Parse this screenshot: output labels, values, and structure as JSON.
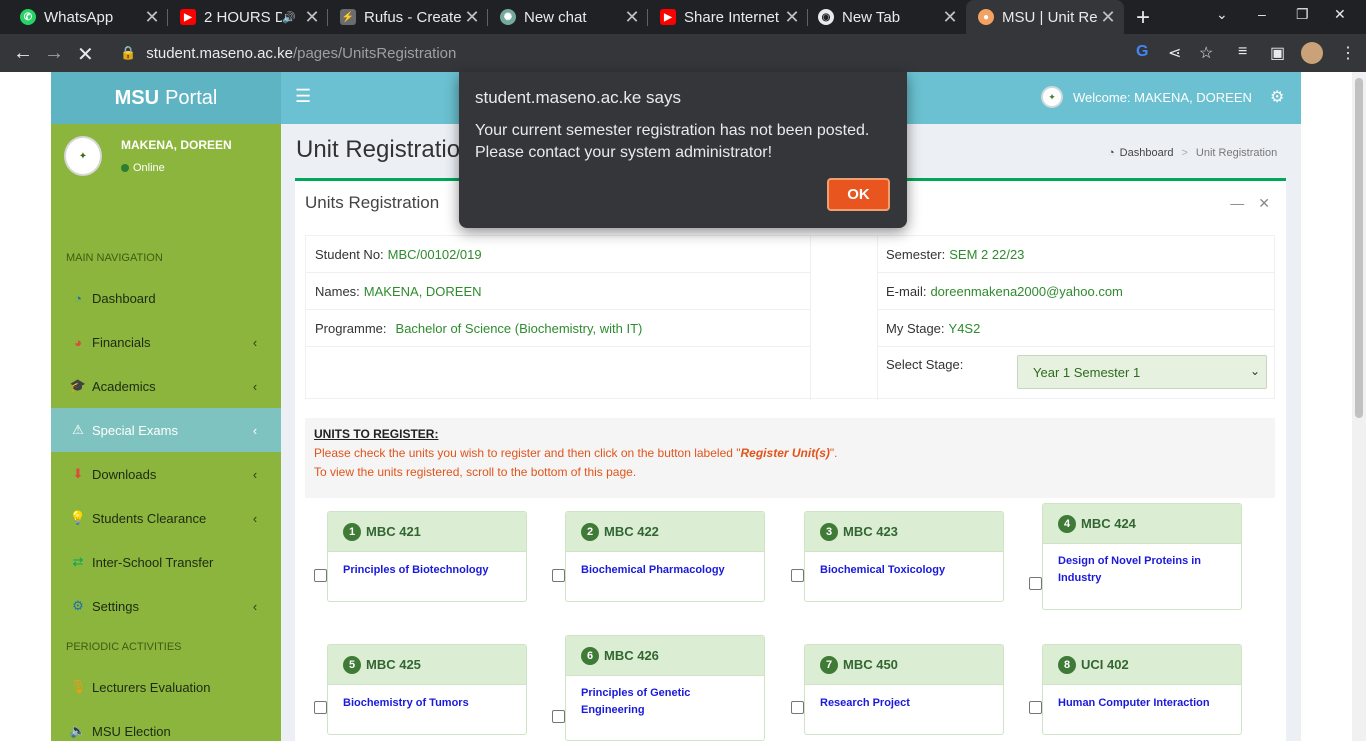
{
  "browser": {
    "tabs": [
      {
        "title": "WhatsApp",
        "icon": "whatsapp-icon",
        "color": "#25d366"
      },
      {
        "title": "2 HOURS D",
        "icon": "youtube-icon",
        "color": "#ff0000",
        "audio": "🔊"
      },
      {
        "title": "Rufus - Create",
        "icon": "rufus-icon",
        "color": "#7a7a7a"
      },
      {
        "title": "New chat",
        "icon": "chatgpt-icon",
        "color": "#74aa9c"
      },
      {
        "title": "Share Internet",
        "icon": "youtube-icon",
        "color": "#ff0000"
      },
      {
        "title": "New Tab",
        "icon": "chrome-icon",
        "color": "#e8eaed"
      },
      {
        "title": "MSU | Unit Reg",
        "icon": "msu-icon",
        "color": "#f4a261"
      }
    ],
    "url_host": "student.maseno.ac.ke",
    "url_path": "/pages/UnitsRegistration"
  },
  "header": {
    "logo_bold": "MSU",
    "logo_rest": "Portal",
    "welcome": "Welcome: MAKENA, DOREEN"
  },
  "sidebar": {
    "user_name": "MAKENA, DOREEN",
    "status": "Online",
    "main_nav_header": "MAIN NAVIGATION",
    "periodic_header": "PERIODIC ACTIVITIES",
    "items": [
      {
        "label": "Dashboard",
        "icon": "dashboard-icon"
      },
      {
        "label": "Financials",
        "icon": "pie-chart-icon"
      },
      {
        "label": "Academics",
        "icon": "graduation-cap-icon"
      },
      {
        "label": "Special Exams",
        "icon": "warning-icon"
      },
      {
        "label": "Downloads",
        "icon": "download-icon"
      },
      {
        "label": "Students Clearance",
        "icon": "lightbulb-icon"
      },
      {
        "label": "Inter-School Transfer",
        "icon": "transfer-icon"
      },
      {
        "label": "Settings",
        "icon": "cogs-icon"
      }
    ],
    "periodic_items": [
      {
        "label": "Lecturers Evaluation",
        "icon": "microphone-icon"
      },
      {
        "label": "MSU Election",
        "icon": "volume-icon"
      }
    ]
  },
  "content": {
    "page_title": "Unit Registration",
    "breadcrumb_home": "Dashboard",
    "breadcrumb_current": "Unit Registration",
    "box_title": "Units Registration"
  },
  "student": {
    "student_no_label": "Student No:",
    "student_no": "MBC/00102/019",
    "names_label": "Names:",
    "names": "MAKENA, DOREEN",
    "programme_label": "Programme:",
    "programme": "Bachelor of Science (Biochemistry, with IT)",
    "semester_label": "Semester:",
    "semester": "SEM 2 22/23",
    "email_label": "E-mail:",
    "email": "doreenmakena2000@yahoo.com",
    "stage_label": "My Stage:",
    "stage": "Y4S2",
    "select_stage_label": "Select Stage:",
    "select_stage_value": "Year 1 Semester 1"
  },
  "instructions": {
    "heading": "UNITS TO REGISTER:",
    "line1_pre": "Please check the units you wish to register and then click on the button labeled \"",
    "line1_em": "Register Unit(s)",
    "line1_post": "\".",
    "line2": "To view the units registered, scroll to the bottom of this page."
  },
  "units": [
    {
      "n": "1",
      "code": "MBC 421",
      "name": "Principles of Biotechnology"
    },
    {
      "n": "2",
      "code": "MBC 422",
      "name": "Biochemical Pharmacology"
    },
    {
      "n": "3",
      "code": "MBC 423",
      "name": "Biochemical Toxicology"
    },
    {
      "n": "4",
      "code": "MBC 424",
      "name": "Design of Novel Proteins in Industry"
    },
    {
      "n": "5",
      "code": "MBC 425",
      "name": "Biochemistry of Tumors"
    },
    {
      "n": "6",
      "code": "MBC 426",
      "name": "Principles of Genetic Engineering"
    },
    {
      "n": "7",
      "code": "MBC 450",
      "name": "Research Project"
    },
    {
      "n": "8",
      "code": "UCI 402",
      "name": "Human Computer Interaction"
    }
  ],
  "dialog": {
    "title": "student.maseno.ac.ke says",
    "message": "Your current semester registration has not been posted. Please contact your system administrator!",
    "ok_label": "OK"
  }
}
